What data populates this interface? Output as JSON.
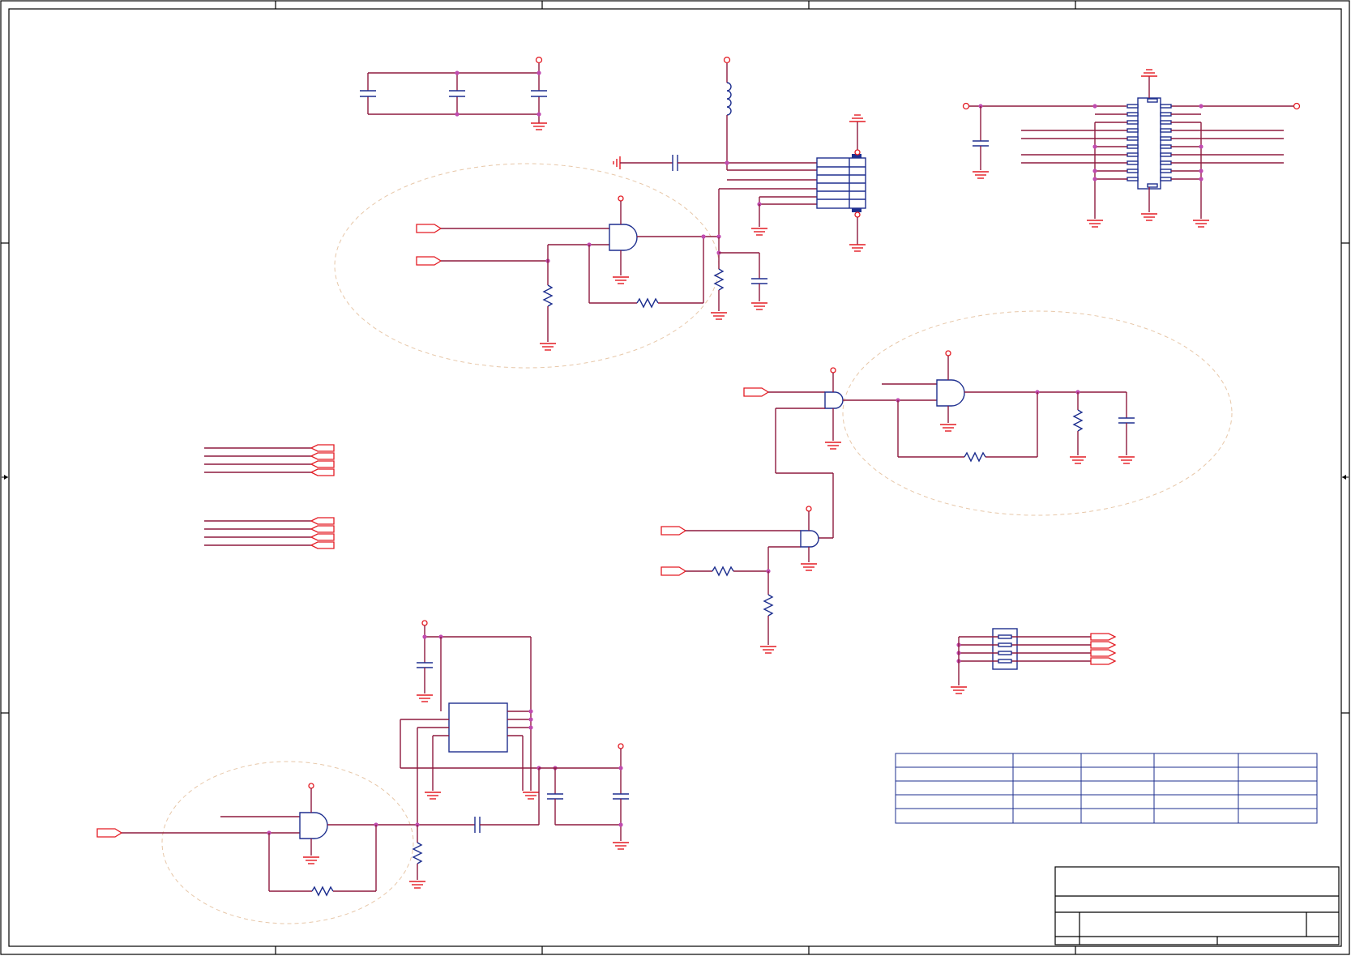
{
  "sheet": {
    "background": "#ffffff",
    "colors": {
      "wire": "#8e1a3e",
      "power_and_ports": "#e31b23",
      "component_body": "#1e2f8f",
      "junction": "#c04bb0",
      "annotation_zone": "#e7c7a8",
      "frame": "#000000"
    },
    "border_zone_markers": [
      "left-arrow-icon",
      "right-arrow-icon"
    ],
    "revision_table": {
      "rows": 5,
      "columns": 5
    },
    "title_block": {
      "fields": "empty"
    }
  }
}
